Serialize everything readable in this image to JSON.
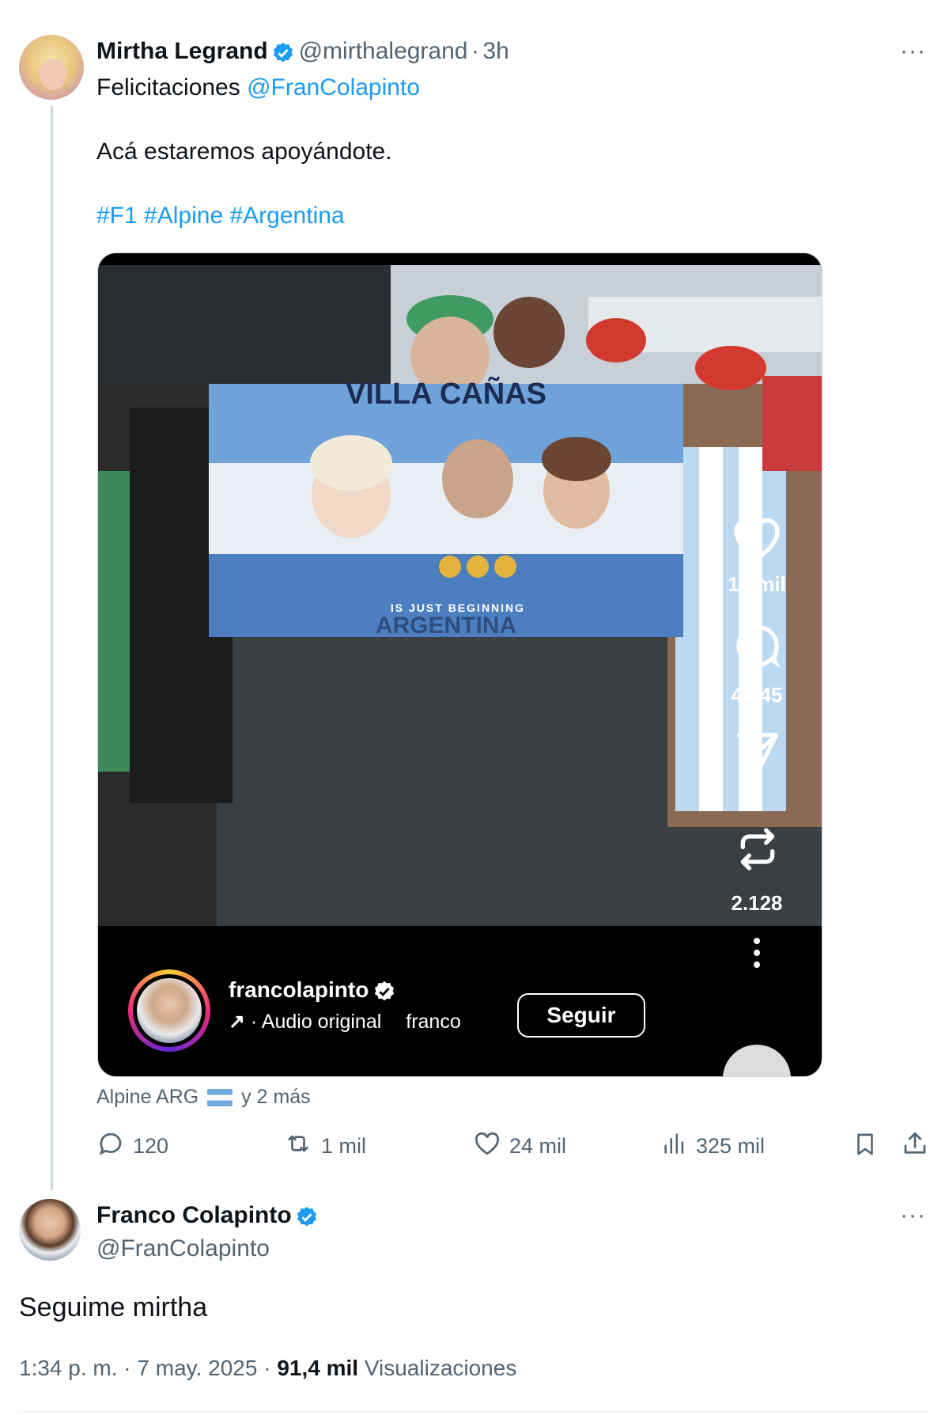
{
  "tweet": {
    "author_name": "Mirtha Legrand",
    "handle": "@mirthalegrand",
    "separator": "·",
    "time": "3h",
    "more": "···",
    "text_line1_prefix": "Felicitaciones",
    "mention": "@FranColapinto",
    "text_line2": "Acá estaremos apoyándote.",
    "hashtags": [
      "#F1",
      "#Alpine",
      "#Argentina"
    ]
  },
  "embedded_media": {
    "flag_top_text": "VILLA CAÑAS",
    "flag_bottom_text": "IS JUST BEGINNING",
    "flag_under_text": "ARGENTINA",
    "likes": "15 mil",
    "comments": "4.045",
    "reposts": "2.128",
    "account": "francolapinto",
    "audio_arrow": "↗",
    "audio": "· Audio original",
    "audio_scroll": "francolap",
    "follow_label": "Seguir"
  },
  "tagged": {
    "label": "Alpine ARG",
    "more": "y 2 más"
  },
  "actions": {
    "replies": "120",
    "reposts": "1 mil",
    "likes": "24 mil",
    "views": "325 mil"
  },
  "reply": {
    "author_name": "Franco Colapinto",
    "handle": "@FranColapinto",
    "more": "···",
    "text": "Seguime mirtha",
    "time": "1:34 p. m.",
    "sep1": "·",
    "date": "7 may. 2025",
    "sep2": "·",
    "views_count": "91,4 mil",
    "views_label": "Visualizaciones"
  },
  "colors": {
    "accent": "#1d9bf0",
    "verified": "#1d9bf0",
    "secondary_text": "#536471",
    "divider": "#cfd9de"
  }
}
